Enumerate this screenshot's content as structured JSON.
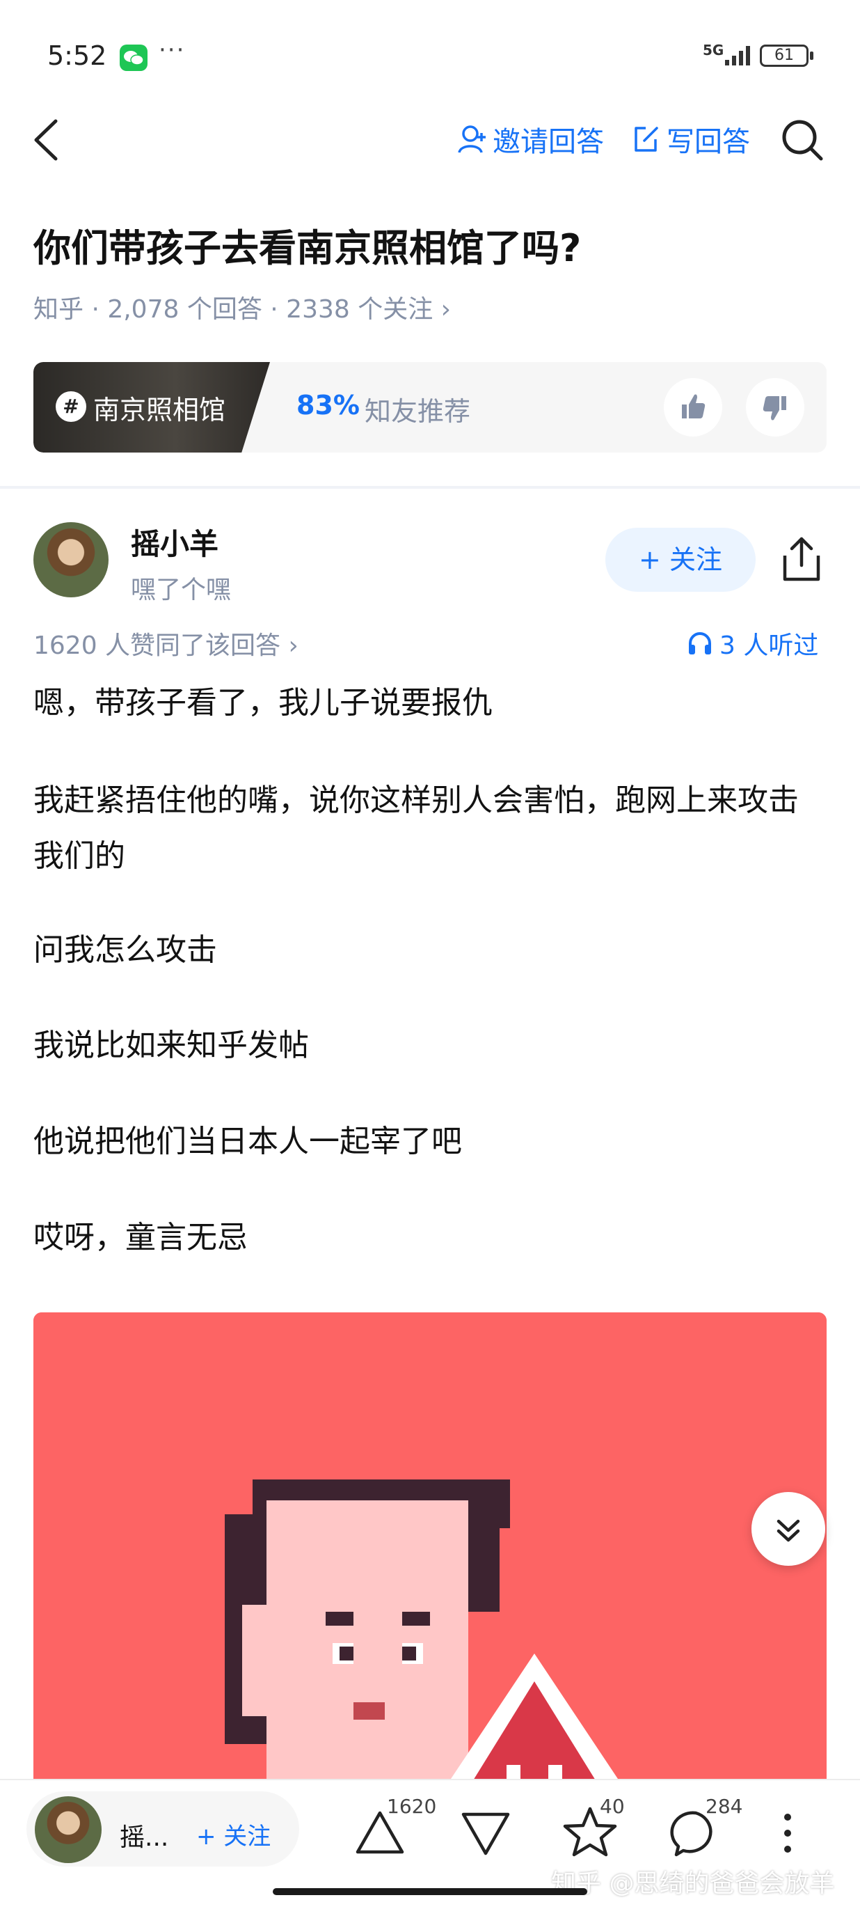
{
  "status_bar": {
    "time": "5:52",
    "dots": "···",
    "network": "5G",
    "battery": "61"
  },
  "nav": {
    "invite_answer": "邀请回答",
    "write_answer": "写回答"
  },
  "question": {
    "title": "你们带孩子去看南京照相馆了吗?",
    "meta": "知乎 · 2,078 个回答 · 2338 个关注 ›"
  },
  "topic_card": {
    "hash": "#",
    "topic": "南京照相馆",
    "percent": "83%",
    "recommend": "知友推荐"
  },
  "author": {
    "name": "摇小羊",
    "bio": "嘿了个嘿",
    "follow": "+ 关注"
  },
  "answer": {
    "likes_line": "1620 人赞同了该回答 ›",
    "listeners": "3 人听过",
    "paragraphs": [
      "嗯，带孩子看了，我儿子说要报仇",
      "我赶紧捂住他的嘴，说你这样别人会害怕，跑网上来攻击我们的",
      "问我怎么攻击",
      "我说比如来知乎发帖",
      "他说把他们当日本人一起宰了吧",
      "哎呀，童言无忌"
    ]
  },
  "bottom_bar": {
    "author_short": "摇...",
    "follow": "+ 关注",
    "upvote_count": "1620",
    "favorite_count": "40",
    "comment_count": "284",
    "watermark": "知乎 @思绮的爸爸会放羊"
  },
  "colors": {
    "accent": "#1772f6",
    "image_bg": "#fd6464",
    "wechat": "#1ec655"
  }
}
